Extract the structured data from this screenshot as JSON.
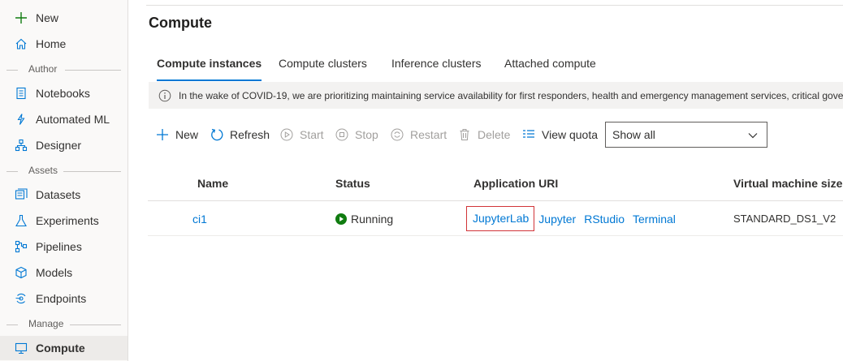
{
  "sidebar": {
    "new_label": "New",
    "home_label": "Home",
    "section_author": "Author",
    "notebooks_label": "Notebooks",
    "automl_label": "Automated ML",
    "designer_label": "Designer",
    "section_assets": "Assets",
    "datasets_label": "Datasets",
    "experiments_label": "Experiments",
    "pipelines_label": "Pipelines",
    "models_label": "Models",
    "endpoints_label": "Endpoints",
    "section_manage": "Manage",
    "compute_label": "Compute",
    "active_item": "Compute"
  },
  "page": {
    "title": "Compute"
  },
  "tabs": [
    {
      "label": "Compute instances",
      "active": true
    },
    {
      "label": "Compute clusters",
      "active": false
    },
    {
      "label": "Inference clusters",
      "active": false
    },
    {
      "label": "Attached compute",
      "active": false
    }
  ],
  "banner": {
    "text": "In the wake of COVID-19, we are prioritizing maintaining service availability for first responders, health and emergency management services, critical govern"
  },
  "toolbar": {
    "new_label": "New",
    "refresh_label": "Refresh",
    "start_label": "Start",
    "stop_label": "Stop",
    "restart_label": "Restart",
    "delete_label": "Delete",
    "view_quota_label": "View quota",
    "filter_value": "Show all"
  },
  "table": {
    "headers": {
      "name": "Name",
      "status": "Status",
      "app_uri": "Application URI",
      "vm_size": "Virtual machine size"
    },
    "rows": [
      {
        "name": "ci1",
        "status": "Running",
        "links": {
          "jupyterlab": "JupyterLab",
          "jupyter": "Jupyter",
          "rstudio": "RStudio",
          "terminal": "Terminal"
        },
        "vm_size": "STANDARD_DS1_V2"
      }
    ]
  },
  "colors": {
    "accent": "#0078d4",
    "running": "#107c10",
    "highlight_box": "#d13438"
  }
}
